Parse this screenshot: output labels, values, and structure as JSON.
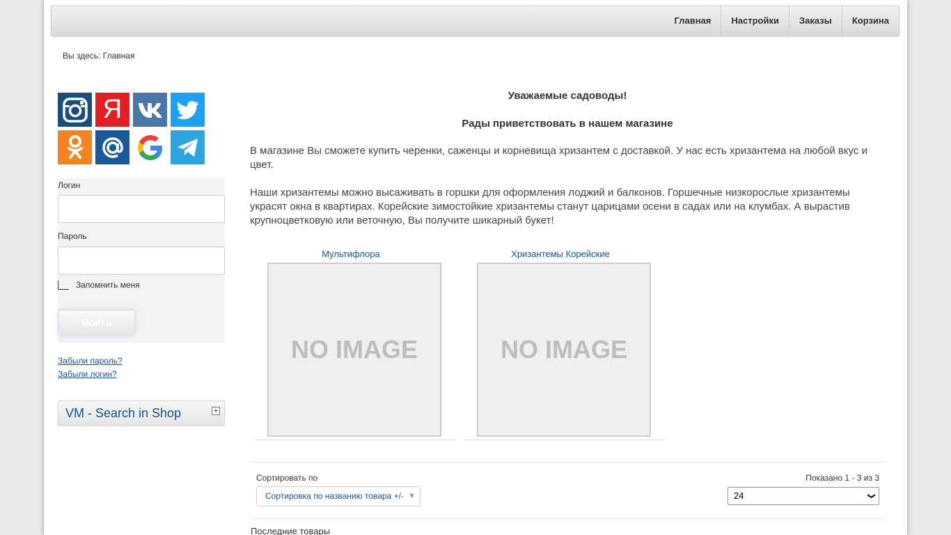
{
  "nav": {
    "items": [
      "Главная",
      "Настройки",
      "Заказы",
      "Корзина"
    ]
  },
  "breadcrumb": "Вы здесь: Главная",
  "social": {
    "icons": [
      "instagram-icon",
      "yandex-icon",
      "vk-icon",
      "twitter-icon",
      "odnoklassniki-icon",
      "mailru-icon",
      "google-icon",
      "telegram-icon"
    ],
    "colors": [
      "#1b4f7b",
      "#e31e24",
      "#4a76a8",
      "#1da1f2",
      "#f58220",
      "#1b5a9a",
      "#ffffff",
      "#2ca5e0"
    ],
    "yandex_glyph": "Я"
  },
  "login": {
    "login_label": "Логин",
    "password_label": "Пароль",
    "remember_label": "Запомнить меня",
    "submit_label": "Войти",
    "login_value": "",
    "password_value": ""
  },
  "links": {
    "forgot_password": "Забыли пароль?",
    "forgot_login": "Забыли логин?"
  },
  "search_module": {
    "title": "VM - Search in Shop",
    "toggle": "+"
  },
  "main": {
    "heading1": "Уважаемые садоводы!",
    "heading2": "Рады приветствовать в нашем магазине",
    "para1": "В магазине Вы сможете купить черенки, саженцы и корневища хризантем с доставкой. У нас есть хризантема на любой вкус и цвет.",
    "para2": "Наши хризантемы можно высаживать в горшки для оформления лоджий и балконов. Горшечные низкорослые хризантемы украсят окна в квартирах. Корейские зимостойкие хризантемы станут царицами осени в садах или на клумбах. А вырастив крупноцветковую или веточную, Вы получите шикарный букет!"
  },
  "products": [
    {
      "name": "Мультифлора",
      "image_text": "NO IMAGE"
    },
    {
      "name": "Хризантемы Корейские",
      "image_text": "NO IMAGE"
    }
  ],
  "sort": {
    "label": "Сортировать по",
    "button": "Сортировка по названию товара +/-"
  },
  "pagination": {
    "shown": "Показано 1 - 3 из 3",
    "limit_value": "24"
  },
  "latest_title": "Последние товары"
}
